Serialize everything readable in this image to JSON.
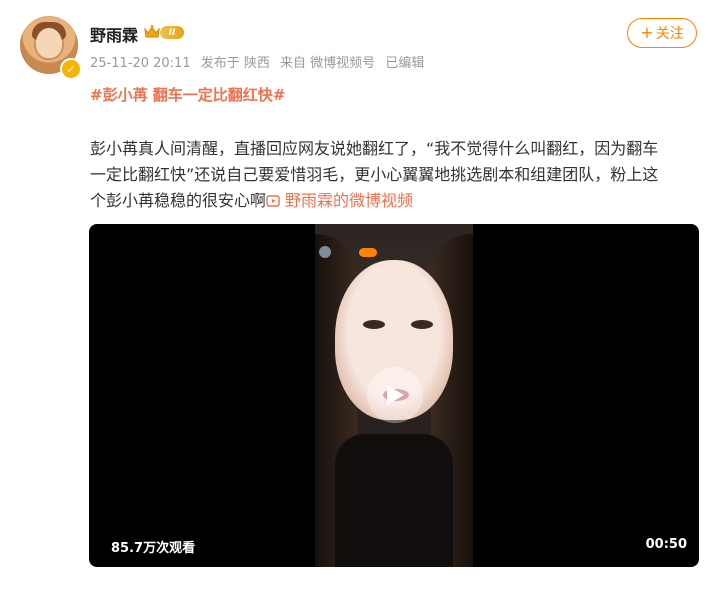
{
  "post": {
    "author": {
      "name": "野雨霖",
      "level_badge": "II"
    },
    "meta": {
      "timestamp": "25-11-20 20:11",
      "location": "发布于 陕西",
      "source": "来自 微博视频号",
      "edited": "已编辑"
    },
    "follow_label": "关注",
    "hashtag": "#彭小苒 翻车一定比翻红快#",
    "text_lines": [
      "彭小苒真人间清醒，直播回应网友说她翻红了，“我不觉得什么叫翻红，因为翻车",
      "一定比翻红快”还说自己要爱惜羽毛，更小心翼翼地挑选剧本和组建团队，粉上这",
      "个彭小苒稳稳的很安心啊"
    ],
    "video_link_label": "野雨霖的微博视频"
  },
  "video": {
    "view_count": "85.7万次观看",
    "duration": "00:50"
  },
  "colors": {
    "accent": "#ff8200",
    "link": "#eb7350",
    "verified": "#f6b400"
  },
  "icons": [
    "crown-icon",
    "verified-icon",
    "play-icon",
    "video-link-icon",
    "plus-icon"
  ]
}
